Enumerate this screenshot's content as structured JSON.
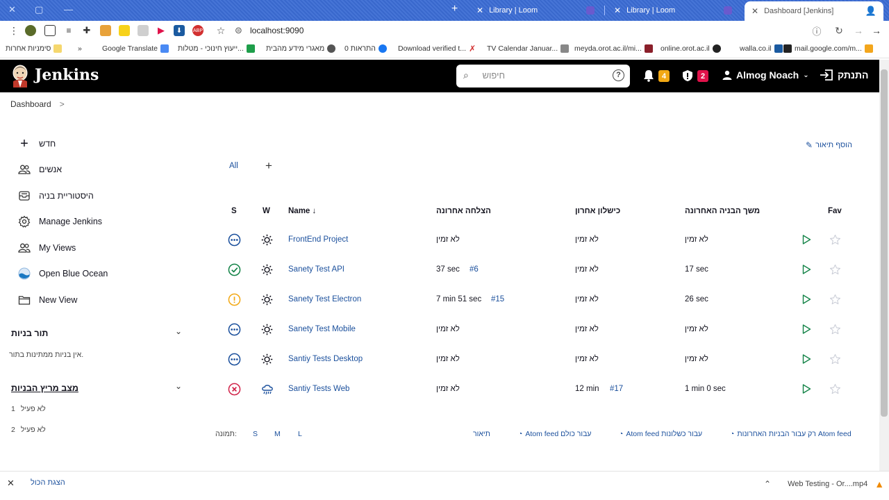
{
  "browser": {
    "tabs": [
      {
        "label": "Library | Loom"
      },
      {
        "label": "Library | Loom"
      },
      {
        "label": "Dashboard [Jenkins]"
      }
    ],
    "url": "localhost:9090",
    "bookmarks": [
      "סימניות אחרות",
      "Google Translate",
      "ייעוץ חינוכי - מטלות...",
      "מאגרי מידע מהבית",
      "0 התראות",
      "Download verified t...",
      "TV Calendar Januar...",
      "meyda.orot.ac.il/mi...",
      "online.orot.ac.il",
      "walla.co.il",
      "mail.google.com/m..."
    ],
    "bookmark_overflow": "»"
  },
  "header": {
    "title": "Jenkins",
    "search_placeholder": "חיפוש",
    "notifications_count": "4",
    "security_count": "2",
    "user_name": "Almog Noach",
    "logout_label": "התנתק",
    "notif_color": "#f2a814",
    "security_color": "#e0124a"
  },
  "breadcrumb": {
    "dashboard": "Dashboard",
    "sep": ">"
  },
  "sidebar": {
    "items": [
      {
        "label": "חדש",
        "icon": "plus-icon"
      },
      {
        "label": "אנשים",
        "icon": "people-icon"
      },
      {
        "label": "היסטוריית בניה",
        "icon": "history-icon"
      },
      {
        "label": "Manage Jenkins",
        "icon": "gear-icon"
      },
      {
        "label": "My Views",
        "icon": "people-icon"
      },
      {
        "label": "Open Blue Ocean",
        "icon": "blue-ocean-icon"
      },
      {
        "label": "New View",
        "icon": "folder-icon"
      }
    ],
    "build_queue": {
      "title": "תור בניות",
      "empty": "אין בניות ממתינות בתור."
    },
    "executors": {
      "title": "מצב מריץ הבניות",
      "rows": [
        {
          "num": "1",
          "status": "לא פעיל"
        },
        {
          "num": "2",
          "status": "לא פעיל"
        }
      ]
    }
  },
  "main": {
    "add_description": "הוסף תיאור",
    "view_tabs": {
      "all": "All",
      "add": "+"
    },
    "columns": {
      "s": "S",
      "w": "W",
      "name": "Name ↓",
      "last_success": "הצלחה אחרונה",
      "last_failure": "כישלון אחרון",
      "last_duration": "משך הבניה האחרונה",
      "fav": "Fav"
    },
    "jobs": [
      {
        "name": "FrontEnd Project",
        "status": "not-built",
        "weather": "sunny",
        "last_success": "לא זמין",
        "last_success_build": "",
        "last_failure": "לא זמין",
        "last_failure_build": "",
        "duration": "לא זמין"
      },
      {
        "name": "Sanety Test API",
        "status": "success",
        "weather": "sunny",
        "last_success": "37 sec",
        "last_success_build": "#6",
        "last_failure": "לא זמין",
        "last_failure_build": "",
        "duration": "17 sec"
      },
      {
        "name": "Sanety Test Electron",
        "status": "unstable",
        "weather": "sunny",
        "last_success": "7 min 51 sec",
        "last_success_build": "#15",
        "last_failure": "לא זמין",
        "last_failure_build": "",
        "duration": "26 sec"
      },
      {
        "name": "Sanety Test Mobile",
        "status": "not-built",
        "weather": "sunny",
        "last_success": "לא זמין",
        "last_success_build": "",
        "last_failure": "לא זמין",
        "last_failure_build": "",
        "duration": "לא זמין"
      },
      {
        "name": "Santiy Tests Desktop",
        "status": "not-built",
        "weather": "sunny",
        "last_success": "לא זמין",
        "last_success_build": "",
        "last_failure": "לא זמין",
        "last_failure_build": "",
        "duration": "לא זמין"
      },
      {
        "name": "Santiy Tests Web",
        "status": "failed",
        "weather": "rain",
        "last_success": "לא זמין",
        "last_success_build": "",
        "last_failure": "12 min",
        "last_failure_build": "#17",
        "duration": "1 min 0 sec"
      }
    ],
    "footer": {
      "icon_label": "תמונה:",
      "sizes": [
        "S",
        "M",
        "L"
      ],
      "legend": "תיאור",
      "feed_all": "Atom feed עבור כולם",
      "feed_failures": "Atom feed עבור כשלונות",
      "feed_latest": "רק עבור הבניות האחרונות Atom feed"
    },
    "status_colors": {
      "not-built": "#1a4f9c",
      "success": "#138347",
      "unstable": "#f2a814",
      "failed": "#d1244a"
    }
  },
  "downloads": {
    "show_all": "הצגת הכול",
    "file": "Web Testing - Or....mp4"
  }
}
